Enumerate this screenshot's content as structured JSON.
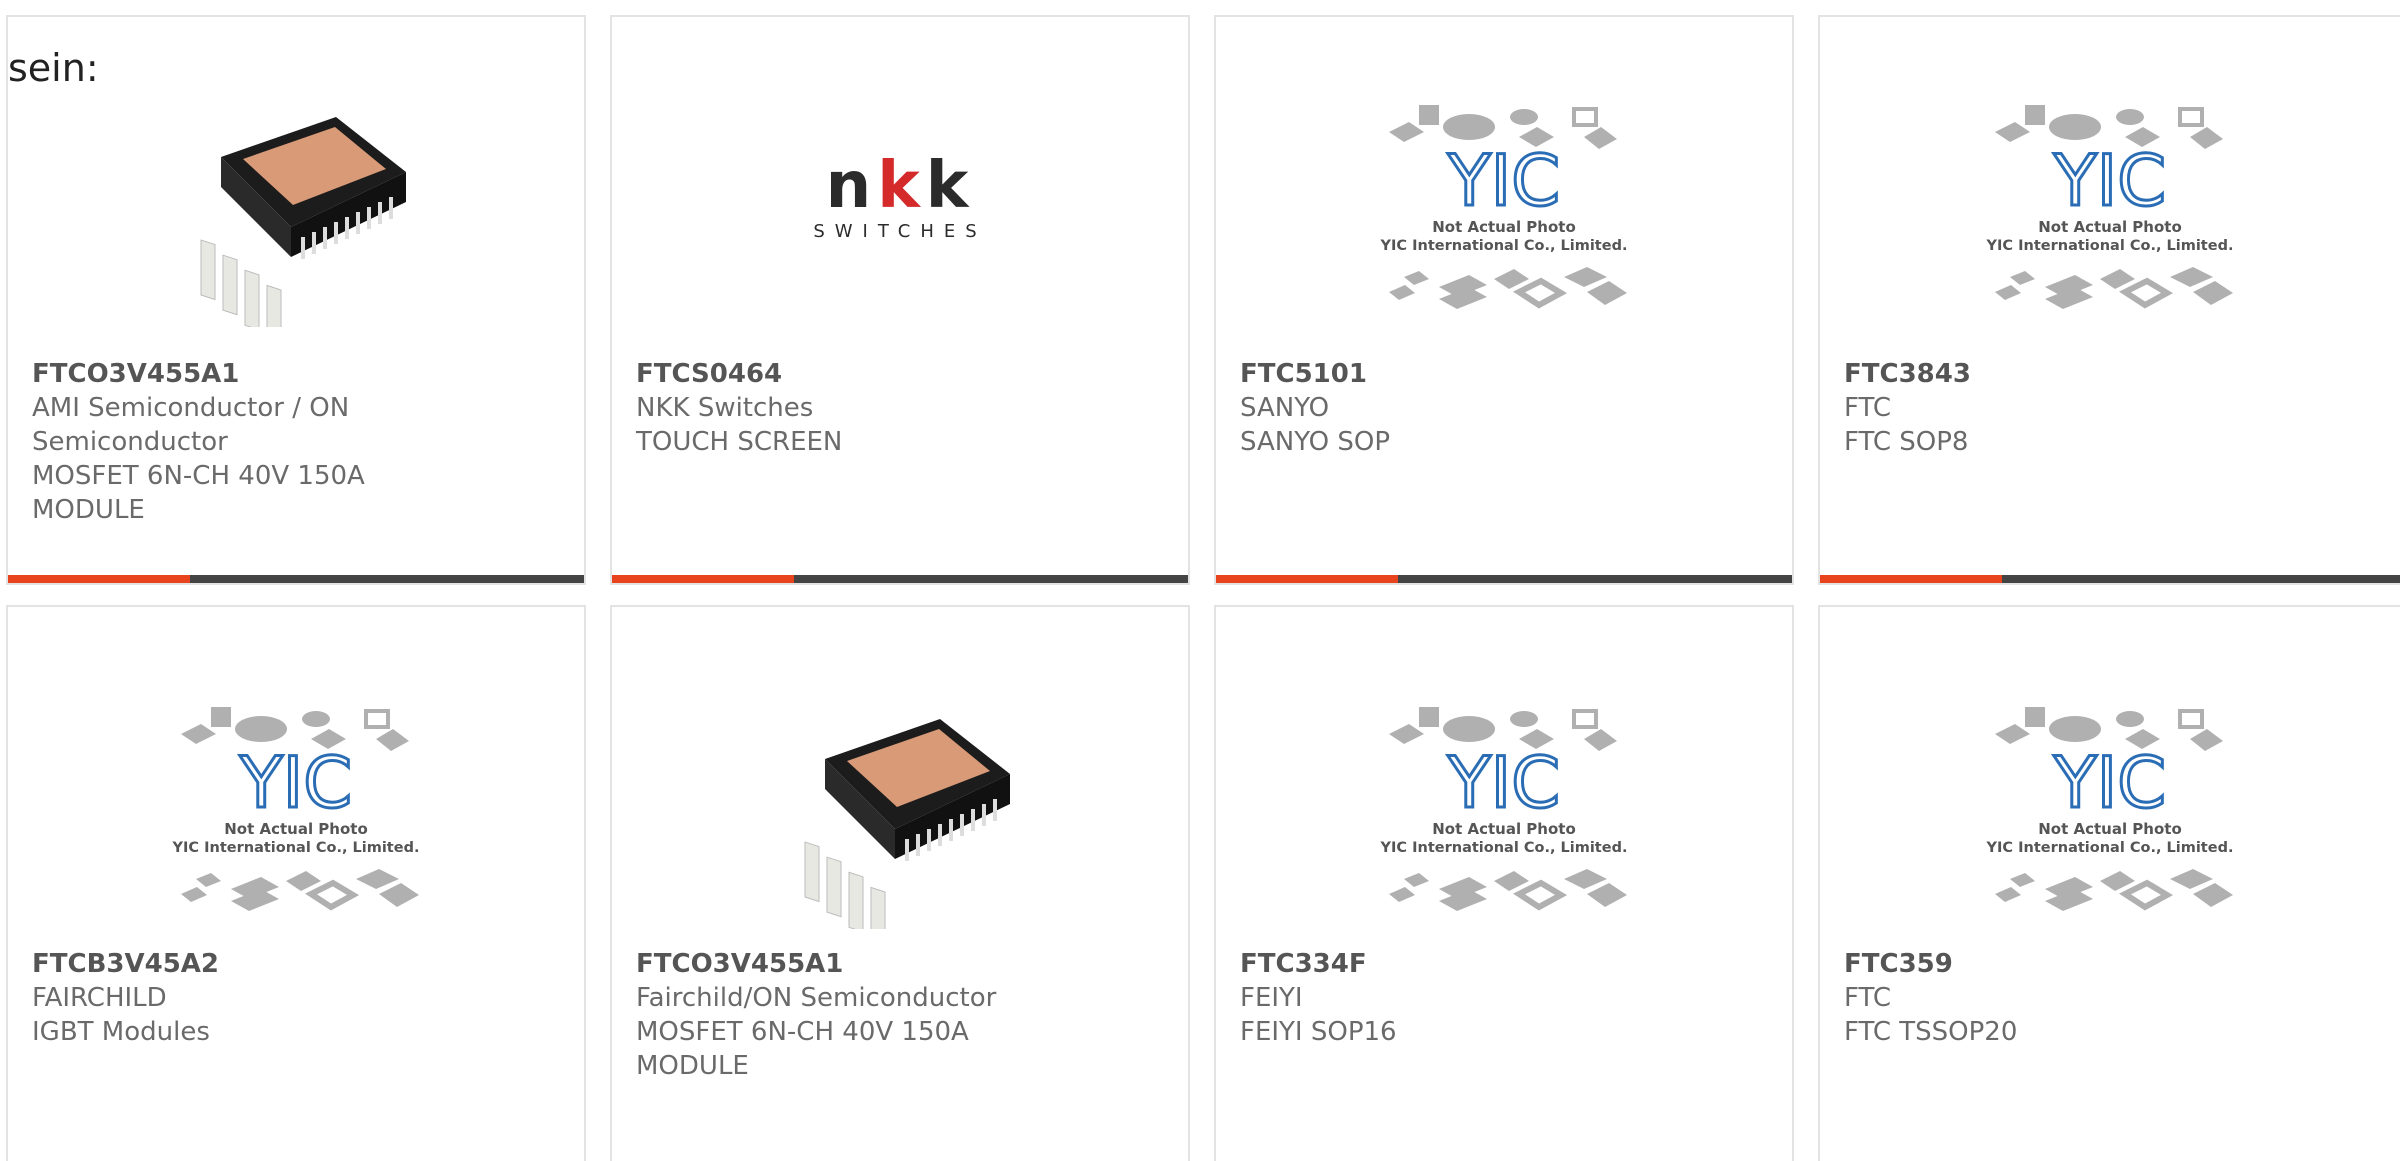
{
  "lead_text": "sein:",
  "colors": {
    "accent": "#e8431c",
    "bar": "#444444",
    "text": "#6a6a6a"
  },
  "products": [
    {
      "image": "ipm-module-chip-photo",
      "part_number": "FTCO3V455A1",
      "lines": [
        "AMI Semiconductor / ON",
        "Semiconductor",
        "MOSFET 6N-CH 40V 150A",
        "MODULE"
      ]
    },
    {
      "image": "nkk-switches-logo",
      "logo_text": "nkk",
      "logo_sub": "SWITCHES",
      "part_number": "FTCS0464",
      "lines": [
        "NKK Switches",
        "TOUCH SCREEN"
      ]
    },
    {
      "image": "yic-placeholder",
      "placeholder_line1": "Not Actual Photo",
      "placeholder_line2": "YIC International Co., Limited.",
      "part_number": "FTC5101",
      "lines": [
        "SANYO",
        "SANYO SOP"
      ]
    },
    {
      "image": "yic-placeholder",
      "placeholder_line1": "Not Actual Photo",
      "placeholder_line2": "YIC International Co., Limited.",
      "part_number": "FTC3843",
      "lines": [
        "FTC",
        "FTC SOP8"
      ]
    },
    {
      "image": "yic-placeholder",
      "placeholder_line1": "Not Actual Photo",
      "placeholder_line2": "YIC International Co., Limited.",
      "part_number": "FTCB3V45A2",
      "lines": [
        "FAIRCHILD",
        "IGBT Modules"
      ]
    },
    {
      "image": "ipm-module-chip-photo",
      "part_number": "FTCO3V455A1",
      "lines": [
        "Fairchild/ON Semiconductor",
        "MOSFET 6N-CH 40V 150A",
        "MODULE"
      ]
    },
    {
      "image": "yic-placeholder",
      "placeholder_line1": "Not Actual Photo",
      "placeholder_line2": "YIC International Co., Limited.",
      "part_number": "FTC334F",
      "lines": [
        "FEIYI",
        "FEIYI SOP16"
      ]
    },
    {
      "image": "yic-placeholder",
      "placeholder_line1": "Not Actual Photo",
      "placeholder_line2": "YIC International Co., Limited.",
      "part_number": "FTC359",
      "lines": [
        "FTC",
        "FTC TSSOP20"
      ]
    }
  ]
}
